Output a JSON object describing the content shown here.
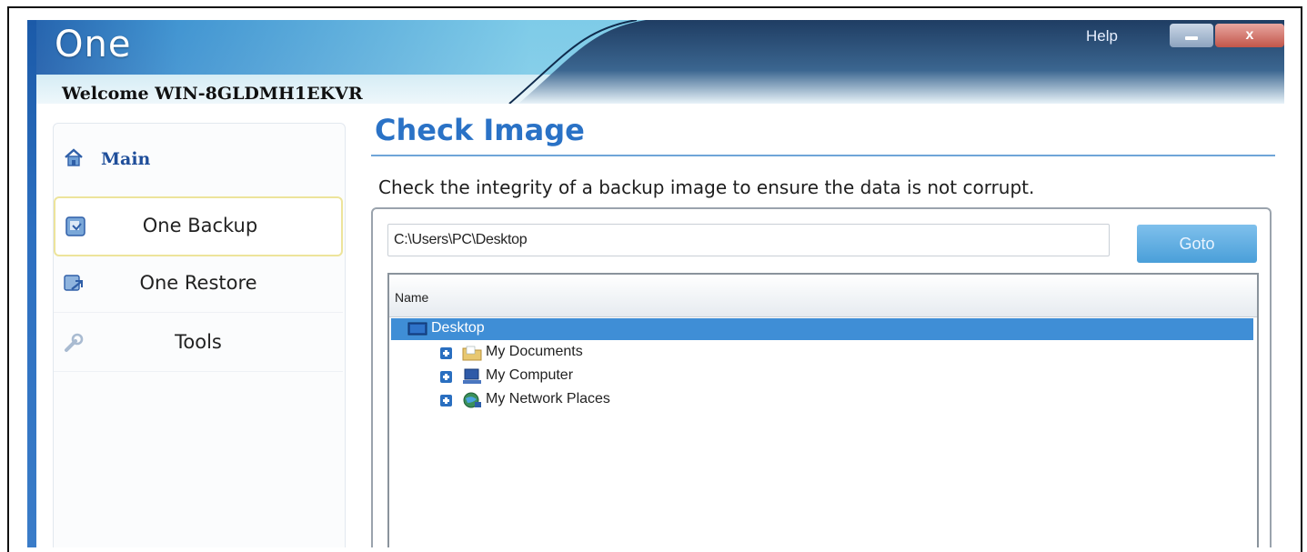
{
  "app": {
    "logo_text": "One",
    "welcome_text": "Welcome WIN-8GLDMH1EKVR",
    "help_label": "Help",
    "close_glyph": "x"
  },
  "sidebar": {
    "main_label": "Main",
    "items": [
      {
        "label": "One Backup",
        "icon": "backup-icon",
        "selected": true
      },
      {
        "label": "One Restore",
        "icon": "restore-icon",
        "selected": false
      },
      {
        "label": "Tools",
        "icon": "tools-icon",
        "selected": false
      }
    ]
  },
  "content": {
    "title": "Check Image",
    "description": "Check the integrity of a backup image to ensure the data is not corrupt.",
    "path_value": "C:\\Users\\PC\\Desktop",
    "goto_label": "Goto"
  },
  "tree": {
    "column_header": "Name",
    "root": {
      "label": "Desktop",
      "icon": "desktop-icon",
      "selected": true
    },
    "children": [
      {
        "label": "My Documents",
        "icon": "folder-icon"
      },
      {
        "label": "My Computer",
        "icon": "computer-icon"
      },
      {
        "label": "My Network Places",
        "icon": "network-icon"
      }
    ]
  },
  "colors": {
    "accent": "#2a72c6",
    "selection": "#3f8ed6",
    "goto_button": "#5aa8de",
    "selected_nav_border": "#ede49b"
  }
}
